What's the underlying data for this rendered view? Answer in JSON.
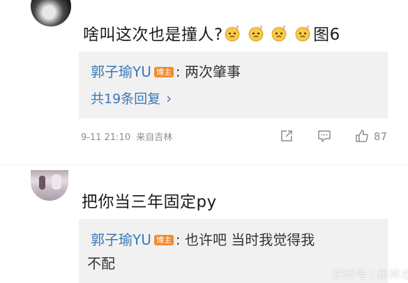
{
  "comments": [
    {
      "text": "啥叫这次也是撞人?",
      "emoji_count": 4,
      "suffix": "图6",
      "reply": {
        "user": "郭子瑜YU",
        "badge": "博主",
        "text": ": 两次肇事"
      },
      "more_replies": "共19条回复",
      "more_chevron": "›",
      "time": "9-11 21:10",
      "source": "来自吉林",
      "like_count": "87"
    },
    {
      "text": "把你当三年固定py",
      "reply": {
        "user": "郭子瑜YU",
        "badge": "博主",
        "text": ": 也许吧 当时我觉得我",
        "text_cont": "不配"
      }
    }
  ],
  "watermark": "快传号 / 新神才"
}
